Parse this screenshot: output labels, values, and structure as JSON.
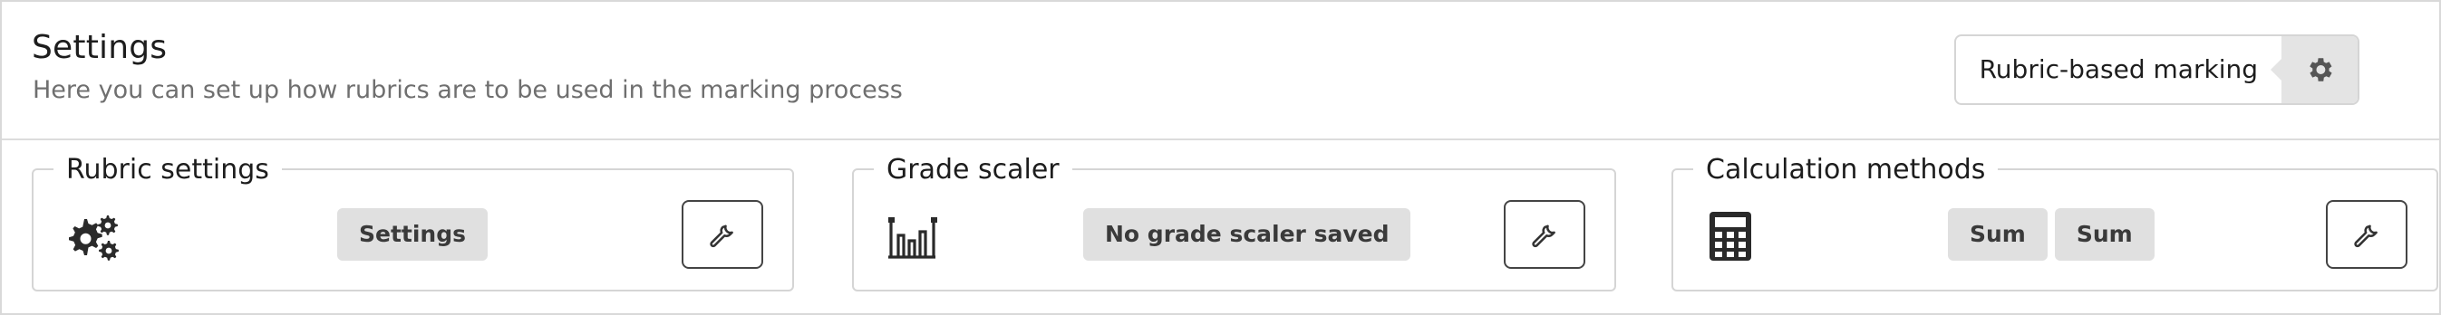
{
  "header": {
    "title": "Settings",
    "subtitle": "Here you can set up how rubrics are to be used in the marking process",
    "mode_label": "Rubric-based marking",
    "mode_icon": "gear-icon"
  },
  "panels": [
    {
      "legend": "Rubric settings",
      "icon": "cogs-icon",
      "chips": [
        "Settings"
      ],
      "action_icon": "wrench-icon"
    },
    {
      "legend": "Grade scaler",
      "icon": "bar-chart-icon",
      "chips": [
        "No grade scaler saved"
      ],
      "action_icon": "wrench-icon"
    },
    {
      "legend": "Calculation methods",
      "icon": "calculator-icon",
      "chips": [
        "Sum",
        "Sum"
      ],
      "action_icon": "wrench-icon"
    }
  ],
  "colors": {
    "border": "#d5d5d5",
    "chip_bg": "#e0e0e0",
    "gear_bg": "#e4e4e4",
    "icon": "#2a2a2a",
    "subtitle": "#6f6f6f"
  }
}
